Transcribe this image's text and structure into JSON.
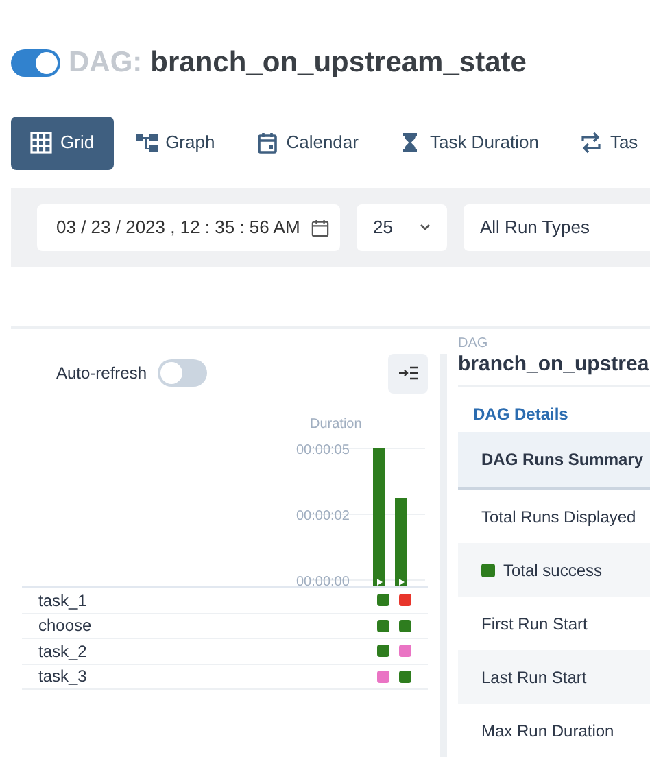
{
  "header": {
    "paused_toggle": {
      "on": true
    },
    "prefix": "DAG:",
    "dag_id": "branch_on_upstream_state"
  },
  "tabs": [
    {
      "label": "Grid",
      "kind": "grid",
      "selected": true
    },
    {
      "label": "Graph",
      "kind": "graph",
      "selected": false
    },
    {
      "label": "Calendar",
      "kind": "calendar",
      "selected": false
    },
    {
      "label": "Task Duration",
      "kind": "duration",
      "selected": false
    },
    {
      "label": "Tas",
      "kind": "tries",
      "selected": false
    }
  ],
  "filters": {
    "execution_date": "03 / 23 / 2023 , 12 : 35 : 56 AM",
    "num_runs": "25",
    "run_type": "All Run Types"
  },
  "grid": {
    "auto_refresh": {
      "label": "Auto-refresh",
      "on": false
    },
    "duration_label": "Duration",
    "chart_data": {
      "type": "bar",
      "yticks": [
        {
          "value": 0,
          "label": "00:00:00"
        },
        {
          "value": 2.5,
          "label": "00:00:02"
        },
        {
          "value": 5,
          "label": "00:00:05"
        }
      ],
      "ylim": [
        0,
        5
      ],
      "series": [
        {
          "color": "#2e7d1e",
          "values": [
            5,
            3.1
          ]
        }
      ]
    },
    "tasks": [
      {
        "name": "task_1",
        "runs": [
          {
            "color": "#2e7d1e"
          },
          {
            "color": "#e8352b"
          }
        ]
      },
      {
        "name": "choose",
        "runs": [
          {
            "color": "#2e7d1e"
          },
          {
            "color": "#2e7d1e"
          }
        ]
      },
      {
        "name": "task_2",
        "runs": [
          {
            "color": "#2e7d1e"
          },
          {
            "color": "#ea74c4"
          }
        ]
      },
      {
        "name": "task_3",
        "runs": [
          {
            "color": "#ea74c4"
          },
          {
            "color": "#2e7d1e"
          }
        ]
      }
    ]
  },
  "details": {
    "label": "DAG",
    "dag_id": "branch_on_upstrea",
    "link": "DAG Details",
    "rows": [
      {
        "kind": "header",
        "label": "DAG Runs Summary"
      },
      {
        "kind": "plain",
        "label": "Total Runs Displayed"
      },
      {
        "kind": "status",
        "label": "Total success",
        "color": "#2e7d1e"
      },
      {
        "kind": "plain",
        "label": "First Run Start"
      },
      {
        "kind": "plain",
        "label": "Last Run Start"
      },
      {
        "kind": "plain",
        "label": "Max Run Duration"
      }
    ]
  }
}
